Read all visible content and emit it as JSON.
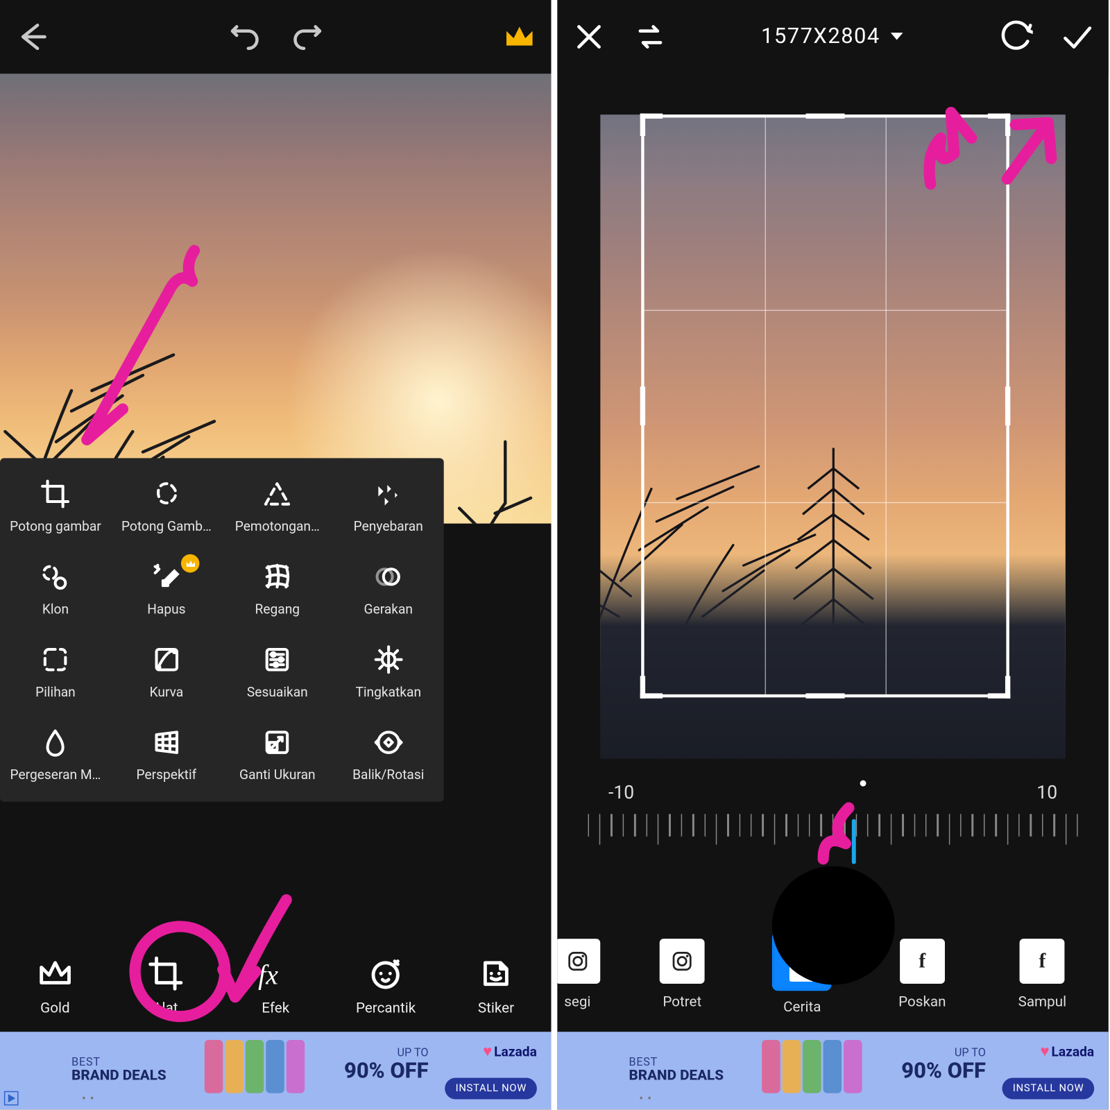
{
  "left": {
    "tools": [
      {
        "label": "Potong gambar"
      },
      {
        "label": "Potong Gamb…"
      },
      {
        "label": "Pemotongan…"
      },
      {
        "label": "Penyebaran"
      },
      {
        "label": "Klon"
      },
      {
        "label": "Hapus"
      },
      {
        "label": "Regang"
      },
      {
        "label": "Gerakan"
      },
      {
        "label": "Pilihan"
      },
      {
        "label": "Kurva"
      },
      {
        "label": "Sesuaikan"
      },
      {
        "label": "Tingkatkan"
      },
      {
        "label": "Pergeseran M…"
      },
      {
        "label": "Perspektif"
      },
      {
        "label": "Ganti Ukuran"
      },
      {
        "label": "Balik/Rotasi"
      }
    ],
    "nav": [
      {
        "label": "Gold"
      },
      {
        "label": "Alat"
      },
      {
        "label": "Efek"
      },
      {
        "label": "Percantik"
      },
      {
        "label": "Stiker"
      }
    ]
  },
  "right": {
    "dimensions": "1577X2804",
    "ruler": {
      "left": "-10",
      "right": "10"
    },
    "aspects": [
      {
        "label": "segi"
      },
      {
        "label": "Potret"
      },
      {
        "label": "Cerita",
        "selected": true
      },
      {
        "label": "Poskan"
      },
      {
        "label": "Sampul"
      }
    ]
  },
  "ad": {
    "line1": "BEST",
    "line2": "BRAND DEALS",
    "upto": "UP TO",
    "pct": "90% OFF",
    "brand": "Lazada",
    "cta": "INSTALL NOW"
  }
}
